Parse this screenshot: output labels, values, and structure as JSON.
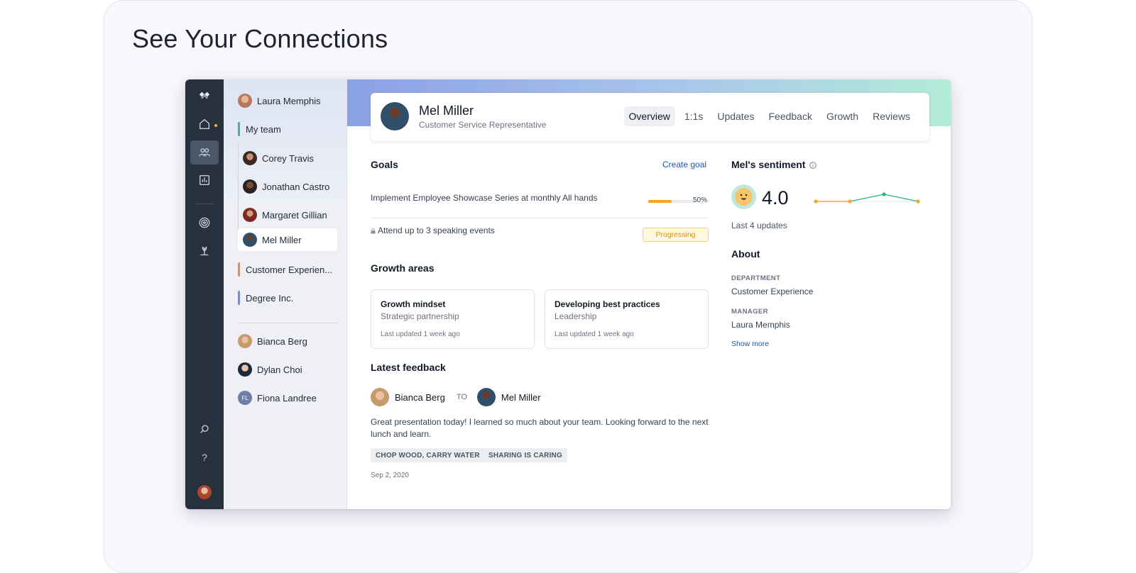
{
  "page": {
    "headline": "See Your Connections"
  },
  "sidebar_nav": {
    "items": [
      {
        "icon": "logo-icon"
      },
      {
        "icon": "home-icon",
        "notification": true
      },
      {
        "icon": "people-icon",
        "active": true
      },
      {
        "icon": "chart-icon"
      },
      {
        "icon": "target-icon"
      },
      {
        "icon": "growth-icon"
      },
      {
        "icon": "search-icon"
      },
      {
        "icon": "help-icon",
        "label": "?"
      },
      {
        "icon": "user-avatar"
      }
    ]
  },
  "people": {
    "top_person": "Laura Memphis",
    "my_team_label": "My team",
    "team_members": [
      "Corey Travis",
      "Jonathan Castro",
      "Margaret Gillian",
      "Mel Miller"
    ],
    "selected_member": "Mel Miller",
    "groups": [
      {
        "label": "Customer Experien...",
        "color": "#f08a4b"
      },
      {
        "label": "Degree Inc.",
        "color": "#6f8be8"
      }
    ],
    "my_team_color": "#3bb79a",
    "others": [
      {
        "name": "Bianca Berg"
      },
      {
        "name": "Dylan Choi"
      },
      {
        "name": "Fiona Landree",
        "initials": "FL"
      }
    ]
  },
  "profile": {
    "name": "Mel Miller",
    "role": "Customer Service Representative",
    "tabs": [
      "Overview",
      "1:1s",
      "Updates",
      "Feedback",
      "Growth",
      "Reviews"
    ],
    "active_tab": "Overview"
  },
  "goals": {
    "title": "Goals",
    "create_label": "Create goal",
    "items": [
      {
        "text": "Implement Employee Showcase Series at monthly All hands",
        "progress": 0.5,
        "progress_label": "50%"
      },
      {
        "text": "Attend up to 3 speaking events",
        "status": "Progressing",
        "locked": true
      }
    ]
  },
  "growth": {
    "title": "Growth areas",
    "cards": [
      {
        "title": "Growth mindset",
        "subtitle": "Strategic partnership",
        "updated": "Last updated 1 week ago"
      },
      {
        "title": "Developing best practices",
        "subtitle": "Leadership",
        "updated": "Last updated 1 week ago"
      }
    ]
  },
  "feedback": {
    "title": "Latest feedback",
    "from": "Bianca Berg",
    "to_label": "TO",
    "to": "Mel Miller",
    "message": "Great presentation today! I learned so much about your team. Looking forward to the next lunch and learn.",
    "tags": [
      "CHOP WOOD, CARRY WATER",
      "SHARING IS CARING"
    ],
    "date": "Sep 2, 2020"
  },
  "sentiment": {
    "title": "Mel's sentiment",
    "score": "4.0",
    "subtitle": "Last 4 updates",
    "trend": [
      4.0,
      4.0,
      4.5,
      4.0
    ],
    "colors": {
      "neutral": "#f3a81c",
      "positive": "#2bb38a"
    }
  },
  "about": {
    "title": "About",
    "department_label": "DEPARTMENT",
    "department": "Customer Experience",
    "manager_label": "MANAGER",
    "manager": "Laura Memphis",
    "show_more": "Show more"
  },
  "colors": {
    "accent_link": "#1a56b8",
    "rail": "#27303d"
  }
}
